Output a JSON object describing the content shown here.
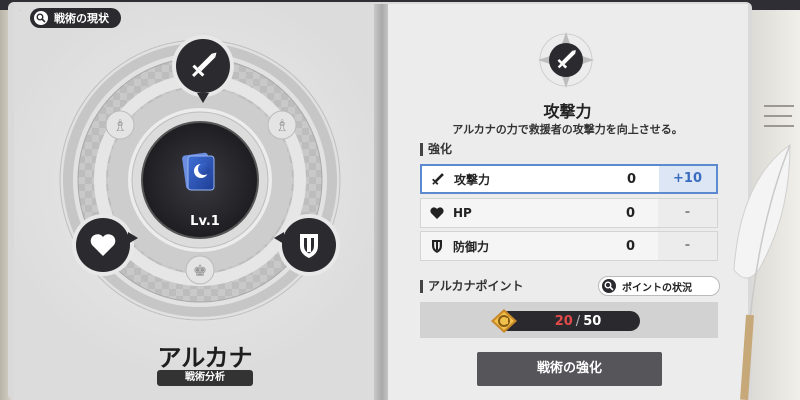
{
  "status_pill": {
    "label": "戦術の現状"
  },
  "arcana": {
    "name": "アルカナ",
    "subtitle": "戦術分析",
    "level": "Lv.1"
  },
  "skill": {
    "icon": "sword-icon",
    "title": "攻撃力",
    "description": "アルカナの力で救援者の攻撃力を向上させる。"
  },
  "enhance_section": {
    "heading": "強化",
    "rows": [
      {
        "icon": "sword-icon",
        "name": "攻撃力",
        "value": "0",
        "bonus": "+10",
        "selected": true
      },
      {
        "icon": "heart-icon",
        "name": "HP",
        "value": "0",
        "bonus": "-",
        "selected": false
      },
      {
        "icon": "shield-icon",
        "name": "防御力",
        "value": "0",
        "bonus": "-",
        "selected": false
      }
    ]
  },
  "arcana_points": {
    "heading": "アルカナポイント",
    "status_button": "ポイントの状況",
    "current": "20",
    "max": "50"
  },
  "actions": {
    "enhance_button": "戦術の強化"
  },
  "colors": {
    "accent_blue": "#3a6dc0",
    "points_red": "#e24a4a",
    "dark_ui": "#2b2b2f"
  }
}
